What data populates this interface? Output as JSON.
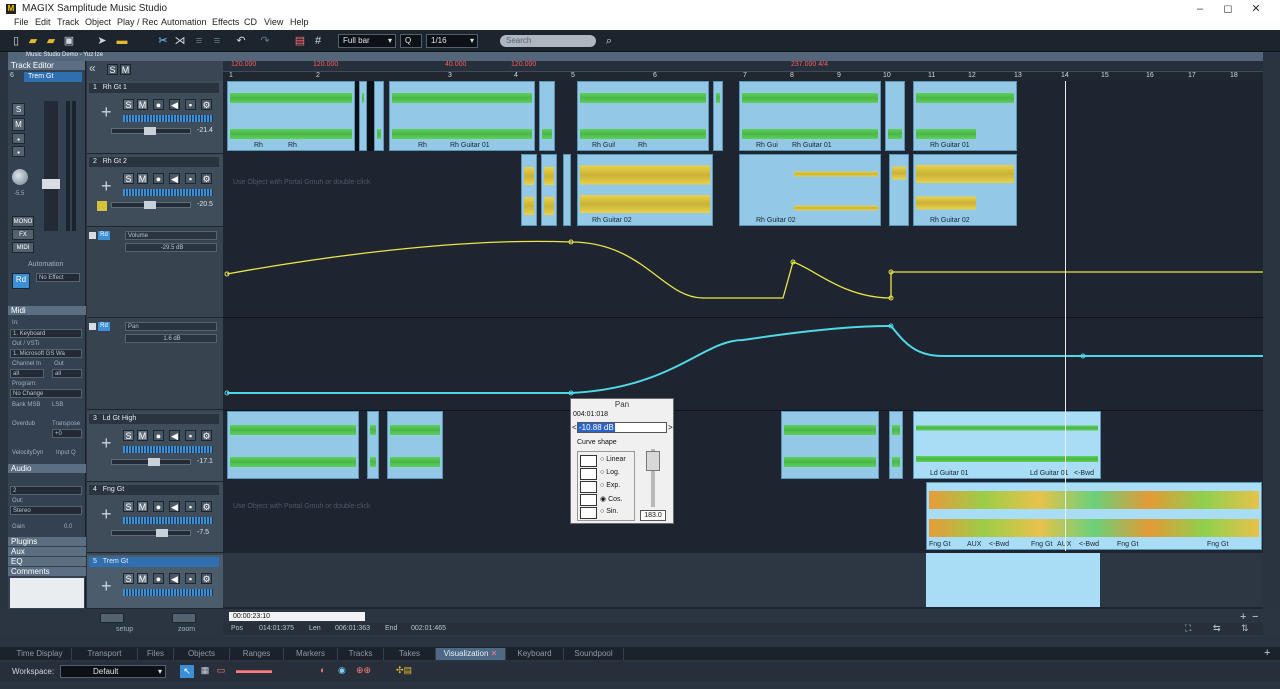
{
  "window": {
    "title": "MAGIX Samplitude Music Studio",
    "logo": "M",
    "minimize": "–",
    "maximize": "◻",
    "close": "✕"
  },
  "menu": [
    "File",
    "Edit",
    "Track",
    "Object",
    "Play / Rec",
    "Automation",
    "Effects",
    "CD",
    "View",
    "Help"
  ],
  "toolbar": {
    "snap": "Full bar",
    "grid_prefix": "Q",
    "grid": "1/16",
    "search_placeholder": "Search"
  },
  "header": {
    "project": "Music Studio Demo - Yuz Ize"
  },
  "left_panel": {
    "section": "Track Editor",
    "selected_track": "Trem Gt",
    "track_num": "6",
    "vol_readout": "-5.5",
    "mono": "MONO",
    "fx": "FX",
    "midi_btn": "MIDI",
    "automation": "Automation",
    "rd": "Rd",
    "no_effect": "No Effect",
    "midi_section": "Midi",
    "in_label": "In:",
    "in_value": "1. Keyboard",
    "out_label": "Out / VSTi",
    "out_value": "1. Microsoft GS Wa",
    "channel_in": "Channel In",
    "channel_out": "Out",
    "all": "all",
    "program": "Program:",
    "no_change": "No Change",
    "bank_msb": "Bank MSB",
    "lsb": "LSB",
    "overdub": "Overdub",
    "transpose": "Transpose",
    "transpose_val": "+0",
    "velocity": "VelocityDyn",
    "input_q": "Input Q",
    "audio_section": "Audio",
    "audio_in": "2",
    "audio_out": "Out:",
    "audio_out_val": "Stereo",
    "gain": "Gain",
    "gain_val": "0.0",
    "plugins": "Plugins",
    "aux": "Aux",
    "eq": "EQ",
    "comments": "Comments",
    "setup": "setup",
    "zoom": "zoom"
  },
  "tracks": [
    {
      "num": "1",
      "name": "Rh Gt 1",
      "volume": "-21.4"
    },
    {
      "num": "2",
      "name": "Rh Gt 2",
      "volume": "-20.5"
    },
    {
      "num": "3",
      "name": "Ld Gt High",
      "volume": "-17.1"
    },
    {
      "num": "4",
      "name": "Fng Gt",
      "volume": "-7.5"
    },
    {
      "num": "5",
      "name": "Trem Gt",
      "volume": ""
    }
  ],
  "automation_lanes": [
    {
      "name": "Volume",
      "value": "-29.5 dB",
      "rd": "Rd",
      "color": "#e8e64a"
    },
    {
      "name": "Pan",
      "value": "1.6 dB",
      "rd": "Rd",
      "color": "#4fd8e6"
    }
  ],
  "ruler": {
    "bars": [
      "1",
      "2",
      "3",
      "4",
      "5",
      "6",
      "7",
      "8",
      "9",
      "10",
      "11",
      "12",
      "13",
      "14",
      "15",
      "16",
      "17",
      "18"
    ],
    "tempo_markers": [
      "120.000",
      "120.000",
      "40.000",
      "120.000",
      "237.000 4/4"
    ]
  },
  "clips": {
    "rh_labels_1": [
      "Rh",
      "Rh",
      "Rh",
      "Rh Guitar 01",
      "Rh Gui!",
      "Rh",
      "Rh Gui",
      "Rh Guitar 01",
      "Rh Guitar 01"
    ],
    "rh_labels_2": [
      "Rh Guitar 02",
      "Rh Guitar 02",
      "Rh Guitar 02"
    ],
    "ld_labels": [
      "Ld Guitar 01",
      "Ld Guitar 01",
      "<-Bwd"
    ],
    "fng_labels": [
      "Fng Gt",
      "AUX",
      "<-Bwd",
      "Fng Gt",
      "AUX",
      "<-Bwd",
      "Fng Gt",
      "Fng Gt"
    ],
    "empty_hint": "Use Object with Portal Gmuh or double-click"
  },
  "pan_dialog": {
    "title": "Pan",
    "position": "004:01:018",
    "value": "-10.88 dB",
    "curve_shape": "Curve shape",
    "shapes": [
      "Linear",
      "Log.",
      "Exp.",
      "Cos.",
      "Sin."
    ],
    "selected": "Cos.",
    "slider_value": "183.0"
  },
  "transport": {
    "time": "00:00:23:10",
    "pos_label": "Pos",
    "pos": "014:01:375",
    "len_label": "Len",
    "len": "006:01:363",
    "end_label": "End",
    "end": "002:01:465"
  },
  "bottom_tabs": [
    "Time Display",
    "Transport",
    "Files",
    "Objects",
    "Ranges",
    "Markers",
    "Tracks",
    "Takes",
    "Visualization",
    "Keyboard",
    "Soundpool"
  ],
  "active_tab": "Visualization",
  "workspace": {
    "label": "Workspace:",
    "value": "Default"
  }
}
